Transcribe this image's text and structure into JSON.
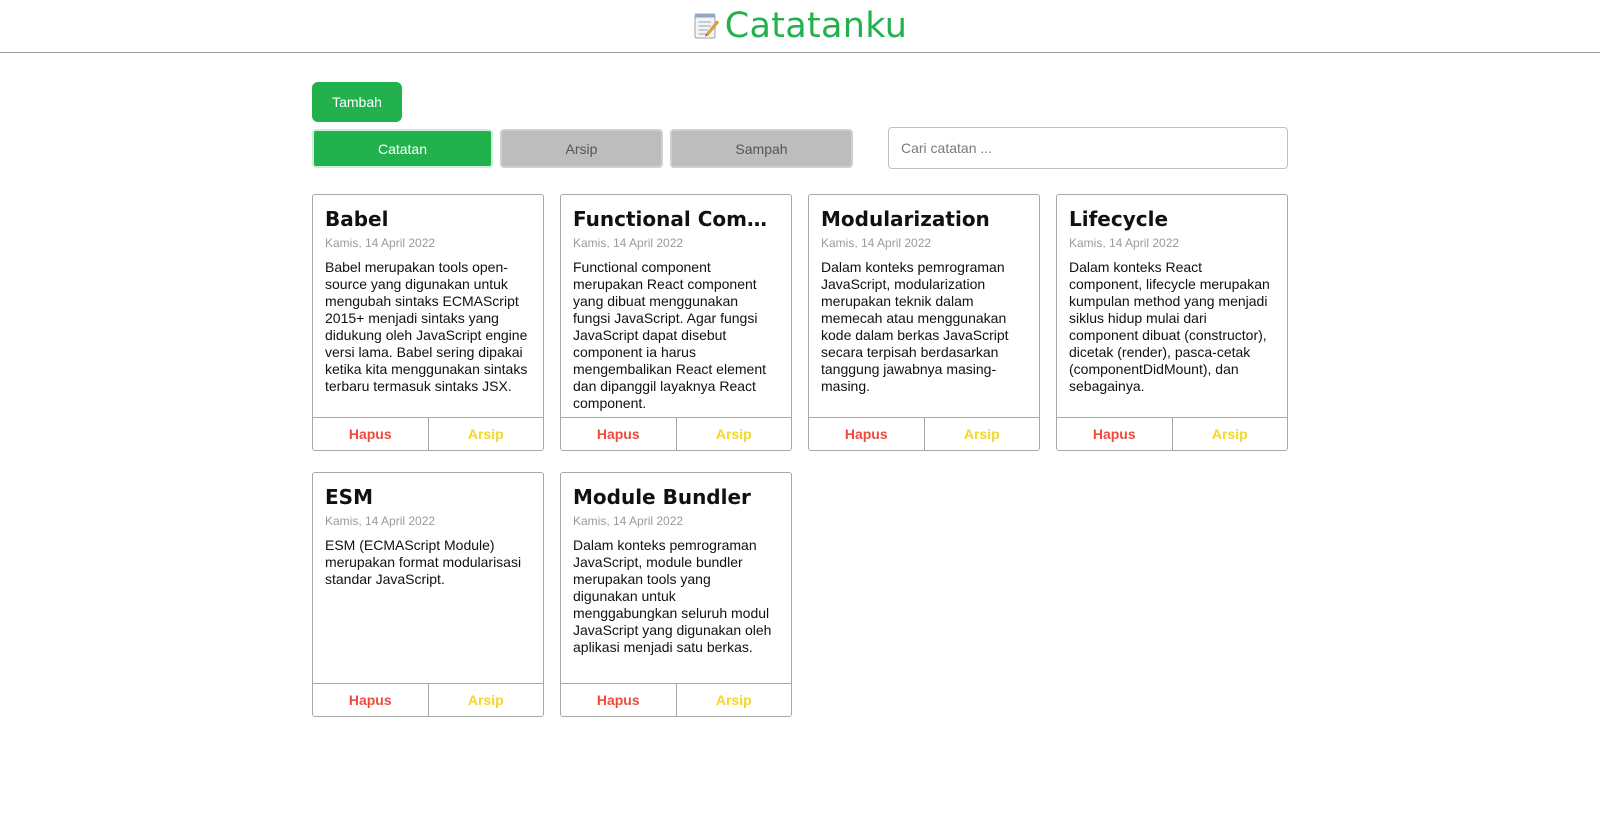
{
  "app": {
    "title": "Catatanku",
    "icon": "memo-icon"
  },
  "actions": {
    "add_label": "Tambah"
  },
  "tabs": [
    {
      "label": "Catatan",
      "active": true
    },
    {
      "label": "Arsip",
      "active": false
    },
    {
      "label": "Sampah",
      "active": false
    }
  ],
  "search": {
    "placeholder": "Cari catatan ...",
    "value": ""
  },
  "colors": {
    "accent": "#22b14c",
    "delete": "#ef4b3c",
    "archive": "#f5d620",
    "inactive_tab": "#bdbdbd"
  },
  "notes": [
    {
      "title": "Babel",
      "date": "Kamis, 14 April 2022",
      "body": "Babel merupakan tools open-source yang digunakan untuk mengubah sintaks ECMAScript 2015+ menjadi sintaks yang didukung oleh JavaScript engine versi lama. Babel sering dipakai ketika kita menggunakan sintaks terbaru termasuk sintaks JSX.",
      "delete_label": "Hapus",
      "archive_label": "Arsip"
    },
    {
      "title": "Functional Compon…",
      "date": "Kamis, 14 April 2022",
      "body": "Functional component merupakan React component yang dibuat menggunakan fungsi JavaScript. Agar fungsi JavaScript dapat disebut component ia harus mengembalikan React element dan dipanggil layaknya React component.",
      "delete_label": "Hapus",
      "archive_label": "Arsip"
    },
    {
      "title": "Modularization",
      "date": "Kamis, 14 April 2022",
      "body": "Dalam konteks pemrograman JavaScript, modularization merupakan teknik dalam memecah atau menggunakan kode dalam berkas JavaScript secara terpisah berdasarkan tanggung jawabnya masing-masing.",
      "delete_label": "Hapus",
      "archive_label": "Arsip"
    },
    {
      "title": "Lifecycle",
      "date": "Kamis, 14 April 2022",
      "body": "Dalam konteks React component, lifecycle merupakan kumpulan method yang menjadi siklus hidup mulai dari component dibuat (constructor), dicetak (render), pasca-cetak (componentDidMount), dan sebagainya.",
      "delete_label": "Hapus",
      "archive_label": "Arsip"
    },
    {
      "title": "ESM",
      "date": "Kamis, 14 April 2022",
      "body": "ESM (ECMAScript Module) merupakan format modularisasi standar JavaScript.",
      "delete_label": "Hapus",
      "archive_label": "Arsip"
    },
    {
      "title": "Module Bundler",
      "date": "Kamis, 14 April 2022",
      "body": "Dalam konteks pemrograman JavaScript, module bundler merupakan tools yang digunakan untuk menggabungkan seluruh modul JavaScript yang digunakan oleh aplikasi menjadi satu berkas.",
      "delete_label": "Hapus",
      "archive_label": "Arsip"
    }
  ]
}
